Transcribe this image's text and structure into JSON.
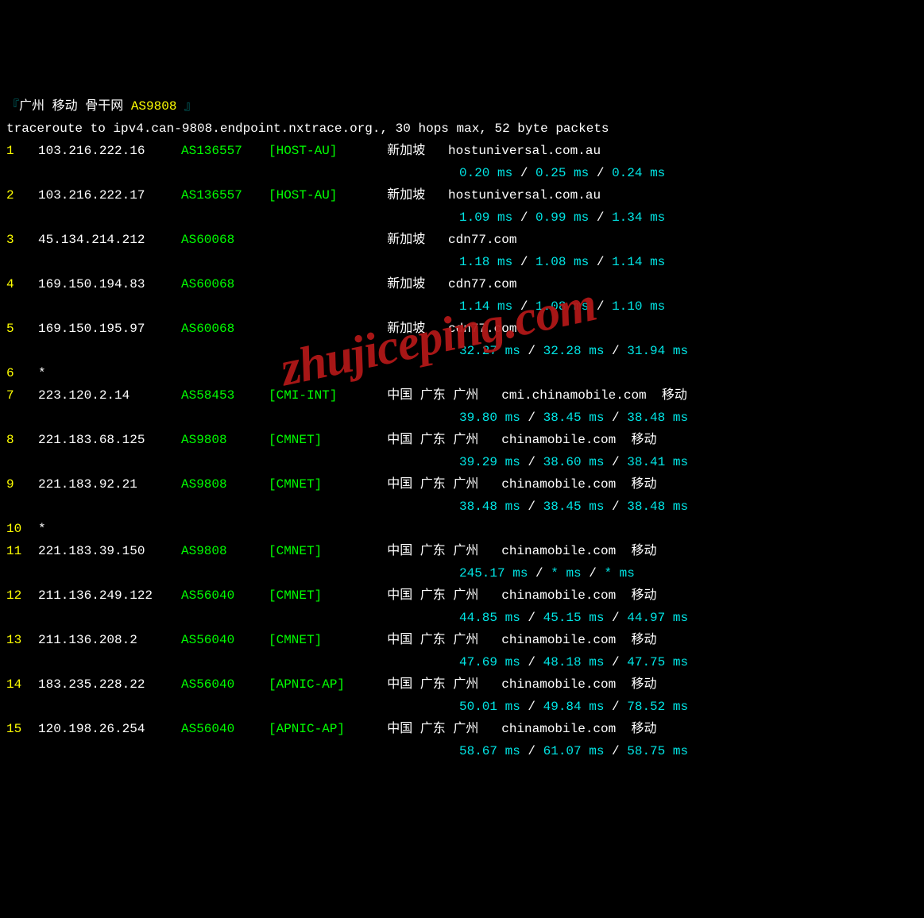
{
  "header": {
    "bracket_open": "『",
    "title": "广州 移动 骨干网",
    "asn": "AS9808",
    "bracket_close": "』"
  },
  "command": "traceroute to ipv4.can-9808.endpoint.nxtrace.org., 30 hops max, 52 byte packets",
  "watermark": "zhujiceping.com",
  "hops": [
    {
      "num": "1",
      "ip": "103.216.222.16",
      "asn": "AS136557",
      "org": "[HOST-AU]",
      "loc": "新加坡",
      "domain": "hostuniversal.com.au",
      "isp": "",
      "t1": "0.20 ms",
      "t2": "0.25 ms",
      "t3": "0.24 ms"
    },
    {
      "num": "2",
      "ip": "103.216.222.17",
      "asn": "AS136557",
      "org": "[HOST-AU]",
      "loc": "新加坡",
      "domain": "hostuniversal.com.au",
      "isp": "",
      "t1": "1.09 ms",
      "t2": "0.99 ms",
      "t3": "1.34 ms"
    },
    {
      "num": "3",
      "ip": "45.134.214.212",
      "asn": "AS60068",
      "org": "",
      "loc": "新加坡",
      "domain": "cdn77.com",
      "isp": "",
      "t1": "1.18 ms",
      "t2": "1.08 ms",
      "t3": "1.14 ms"
    },
    {
      "num": "4",
      "ip": "169.150.194.83",
      "asn": "AS60068",
      "org": "",
      "loc": "新加坡",
      "domain": "cdn77.com",
      "isp": "",
      "t1": "1.14 ms",
      "t2": "1.08 ms",
      "t3": "1.10 ms"
    },
    {
      "num": "5",
      "ip": "169.150.195.97",
      "asn": "AS60068",
      "org": "",
      "loc": "新加坡",
      "domain": "cdn77.com",
      "isp": "",
      "t1": "32.27 ms",
      "t2": "32.28 ms",
      "t3": "31.94 ms"
    },
    {
      "num": "6",
      "ip": "*",
      "asn": "",
      "org": "",
      "loc": "",
      "domain": "",
      "isp": "",
      "t1": "",
      "t2": "",
      "t3": ""
    },
    {
      "num": "7",
      "ip": "223.120.2.14",
      "asn": "AS58453",
      "org": "[CMI-INT]",
      "loc": "中国 广东 广州",
      "domain": "cmi.chinamobile.com",
      "isp": "移动",
      "t1": "39.80 ms",
      "t2": "38.45 ms",
      "t3": "38.48 ms"
    },
    {
      "num": "8",
      "ip": "221.183.68.125",
      "asn": "AS9808",
      "org": "[CMNET]",
      "loc": "中国 广东 广州",
      "domain": "chinamobile.com",
      "isp": "移动",
      "t1": "39.29 ms",
      "t2": "38.60 ms",
      "t3": "38.41 ms"
    },
    {
      "num": "9",
      "ip": "221.183.92.21",
      "asn": "AS9808",
      "org": "[CMNET]",
      "loc": "中国 广东 广州",
      "domain": "chinamobile.com",
      "isp": "移动",
      "t1": "38.48 ms",
      "t2": "38.45 ms",
      "t3": "38.48 ms"
    },
    {
      "num": "10",
      "ip": "*",
      "asn": "",
      "org": "",
      "loc": "",
      "domain": "",
      "isp": "",
      "t1": "",
      "t2": "",
      "t3": ""
    },
    {
      "num": "11",
      "ip": "221.183.39.150",
      "asn": "AS9808",
      "org": "[CMNET]",
      "loc": "中国 广东 广州",
      "domain": "chinamobile.com",
      "isp": "移动",
      "t1": "245.17 ms",
      "t2": "* ms",
      "t3": "* ms"
    },
    {
      "num": "12",
      "ip": "211.136.249.122",
      "asn": "AS56040",
      "org": "[CMNET]",
      "loc": "中国 广东 广州",
      "domain": "chinamobile.com",
      "isp": "移动",
      "t1": "44.85 ms",
      "t2": "45.15 ms",
      "t3": "44.97 ms"
    },
    {
      "num": "13",
      "ip": "211.136.208.2",
      "asn": "AS56040",
      "org": "[CMNET]",
      "loc": "中国 广东 广州",
      "domain": "chinamobile.com",
      "isp": "移动",
      "t1": "47.69 ms",
      "t2": "48.18 ms",
      "t3": "47.75 ms"
    },
    {
      "num": "14",
      "ip": "183.235.228.22",
      "asn": "AS56040",
      "org": "[APNIC-AP]",
      "loc": "中国 广东 广州",
      "domain": "chinamobile.com",
      "isp": "移动",
      "t1": "50.01 ms",
      "t2": "49.84 ms",
      "t3": "78.52 ms"
    },
    {
      "num": "15",
      "ip": "120.198.26.254",
      "asn": "AS56040",
      "org": "[APNIC-AP]",
      "loc": "中国 广东 广州",
      "domain": "chinamobile.com",
      "isp": "移动",
      "t1": "58.67 ms",
      "t2": "61.07 ms",
      "t3": "58.75 ms"
    }
  ]
}
